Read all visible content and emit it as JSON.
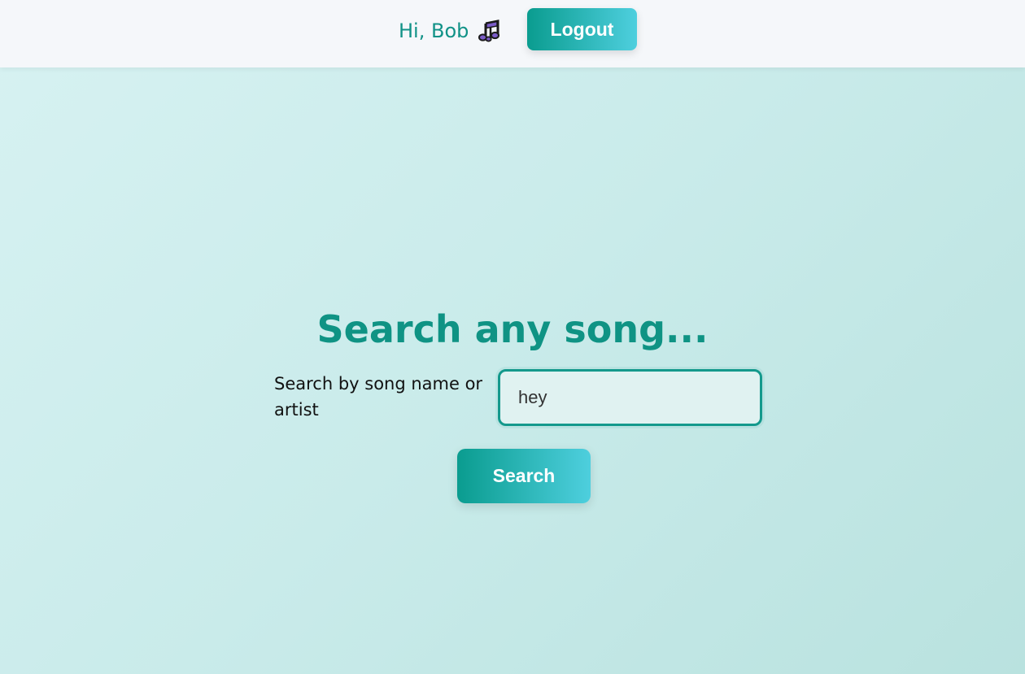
{
  "header": {
    "greeting": "Hi, Bob",
    "icon": "music-notes-icon",
    "logout_label": "Logout"
  },
  "main": {
    "title": "Search any song...",
    "search_label": "Search by song name or artist",
    "search_value": "hey",
    "search_button_label": "Search"
  },
  "colors": {
    "accent": "#0f9384",
    "button_gradient_start": "#0a9c8f",
    "button_gradient_end": "#4ecfde",
    "icon_purple": "#7b5cc8"
  }
}
